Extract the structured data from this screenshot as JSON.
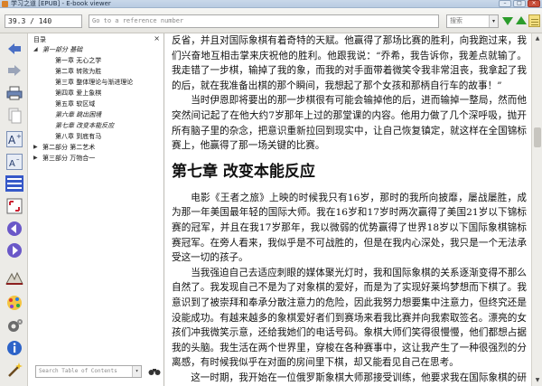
{
  "window": {
    "title": "学习之道 [EPUB] - E-book viewer",
    "controls": {
      "minimize": "–",
      "maximize": "□",
      "close": "×"
    }
  },
  "toolbar": {
    "position_value": "39.3 / 140",
    "reference_placeholder": "Go to a reference number",
    "search_label": "搜索",
    "search_dropdown": "▾"
  },
  "left_icons": [
    "back-arrow-icon",
    "forward-arrow-icon",
    "print-icon",
    "copy-icon",
    "font-larger-icon",
    "font-smaller-icon",
    "toc-icon",
    "fullscreen-icon",
    "previous-page-icon",
    "next-page-icon",
    "bookmark-icon",
    "reference-mode-icon",
    "preferences-icon",
    "metadata-icon",
    "open-ebook-icon"
  ],
  "toc": {
    "header": "目录",
    "close_glyph": "×",
    "items": [
      {
        "label": "第一部分 基础",
        "level": 1,
        "toggle": "◢",
        "italic": true
      },
      {
        "label": "第一章 无心之学",
        "level": 2
      },
      {
        "label": "第二章 转败为胜",
        "level": 2
      },
      {
        "label": "第三章 整体理论与渐进理论",
        "level": 2
      },
      {
        "label": "第四章 爱上象棋",
        "level": 2
      },
      {
        "label": "第五章 软区域",
        "level": 2
      },
      {
        "label": "第六章 跳出困境",
        "level": 2,
        "italic": true
      },
      {
        "label": "第七章 改变本能反应",
        "level": 2,
        "italic": true
      },
      {
        "label": "第八章 到底有马",
        "level": 2
      },
      {
        "label": "第二部分 第二艺术",
        "level": 1,
        "toggle": "▶"
      },
      {
        "label": "第三部分 万物合一",
        "level": 1,
        "toggle": "▶"
      }
    ],
    "search_placeholder": "Search Table of Contents",
    "search_dropdown": "▾"
  },
  "content": {
    "para1": "反省，并且对国际象棋有着奇特的天赋。他赢得了那场比赛的胜利，向我跑过来，我们兴奋地互相击掌来庆祝他的胜利。他跟我说：“乔希，我告诉你，我差点就输了。我走错了一步棋，输掉了我的象，而我的对手面带着微笑令我非常沮丧，我拿起了我的后，就在我准备出棋的那个瞬间，我想起了那个女孩和那柄自行车的故事！”",
    "para2": "当时伊恩即将要出的那一步棋很有可能会输掉他的后，进而输掉一整局，然而他突然间记起了在他大约7岁那年上过的那堂课的内容。他用力做了几个深呼吸，抛开所有脑子里的杂念，把意识重新拉回到现实中，让自己恢复镇定，就这样在全国锦标赛上，他赢得了那一场关键的比赛。",
    "chapter_title": "第七章 改变本能反应",
    "para3": "电影《王者之旅》上映的时候我只有16岁，那时的我所向披靡，屡战屡胜，成为那一年美国最年轻的国际大师。我在16岁和17岁时两次赢得了美国21岁以下锦标赛的冠军，并且在我17岁那年，我以微弱的优势赢得了世界18岁以下国际象棋锦标赛冠军。在旁人看来，我似乎是不可战胜的，但是在我内心深处，我只是一个无法承受这一切的孩子。",
    "para4": "当我强迫自己去适应刺眼的媒体聚光灯时，我和国际象棋的关系逐渐变得不那么自然了。我发现自己不是为了对象棋的爱好，而是为了实现好莱坞梦想而下棋了。我意识到了被崇拜和奉承分散注意力的危险，因此我努力想要集中注意力，但终究还是没能成功。有越来越多的象棋爱好者们到赛场来看我比赛并向我索取签名。漂亮的女孩们冲我微笑示意，还给我她们的电话号码。象棋大师们笑得很慢慢，他们都想占据我的头脑。我生活在两个世界里，穿梭在各种赛事中，这让我产生了一种很强烈的分离感，有时候我似乎在对面的房间里下棋，却又能看见自己在思考。",
    "para5": "这一时期，我开始在一位俄罗斯象棋大师那接受训练，他要求我在国际象棋的研究中，"
  }
}
